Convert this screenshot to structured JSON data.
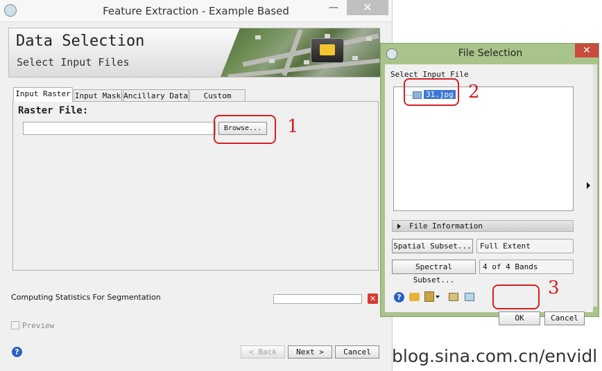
{
  "main_window": {
    "title": "Feature Extraction - Example Based",
    "minimize_glyph": "—",
    "close_glyph": "✕",
    "banner": {
      "heading": "Data Selection",
      "subheading": "Select Input Files",
      "icon": "open-folder-icon"
    },
    "tabs": [
      {
        "label": "Input Raster",
        "active": true
      },
      {
        "label": "Input Mask",
        "active": false
      },
      {
        "label": "Ancillary Data",
        "active": false
      },
      {
        "label": "Custom Bands",
        "active": false
      }
    ],
    "raster_file_label": "Raster File:",
    "raster_file_value": "",
    "browse_label": "Browse...",
    "stats_label": "Computing Statistics For Segmentation",
    "stop_glyph": "✕",
    "preview_label": "Preview",
    "preview_checked": false,
    "help_glyph": "?",
    "back_label": "< Back",
    "next_label": "Next >",
    "cancel_label": "Cancel"
  },
  "file_dialog": {
    "title": "File Selection",
    "close_glyph": "✕",
    "select_label": "Select Input File",
    "files": [
      {
        "name": "31.jpg",
        "selected": true
      }
    ],
    "file_info_label": "File Information",
    "spatial_subset_label": "Spatial Subset...",
    "spatial_subset_value": "Full Extent",
    "spectral_subset_label": "Spectral Subset...",
    "spectral_subset_value": "4 of 4 Bands",
    "ok_label": "OK",
    "cancel_label": "Cancel",
    "help_glyph": "?",
    "toolbar_icons": [
      "help-icon",
      "open-folder-icon",
      "data-manager-icon",
      "export-icon",
      "remote-icon"
    ]
  },
  "annotations": {
    "step1": "1",
    "step2": "2",
    "step3": "3",
    "color": "#d31f1f"
  },
  "watermark": "blog.sina.com.cn/envidl"
}
